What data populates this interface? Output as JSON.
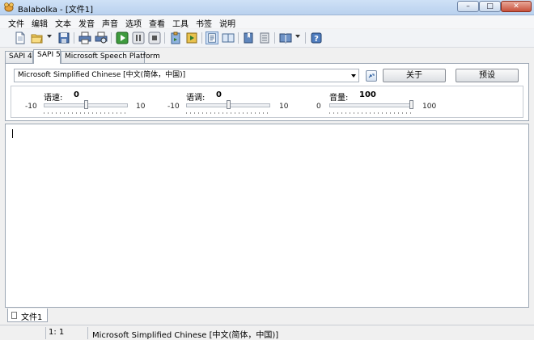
{
  "window": {
    "title": "Balabolka - [文件1]",
    "controls": {
      "minimize": "–",
      "maximize": "□",
      "close": "✕"
    }
  },
  "menu": [
    "文件",
    "编辑",
    "文本",
    "发音",
    "声音",
    "选项",
    "查看",
    "工具",
    "书签",
    "说明"
  ],
  "toolbar_icons": [
    "new-document-icon",
    "open-folder-icon",
    "save-icon",
    "print-icon",
    "print-preview-icon",
    "play-icon",
    "pause-icon",
    "stop-icon",
    "read-clipboard-icon",
    "convert-audio-icon",
    "text-view-icon",
    "split-view-icon",
    "bookmark-icon",
    "bookmarks-list-icon",
    "book-icon",
    "help-icon"
  ],
  "tabs": [
    "SAPI 4",
    "SAPI 5",
    "Microsoft Speech Platform"
  ],
  "selected_tab": "SAPI 5",
  "voice_panel": {
    "voice_value": "Microsoft Simplified Chinese [中文(简体，中国)]",
    "about_button": "关于",
    "preset_button": "预设"
  },
  "sliders": {
    "rate": {
      "label": "语速:",
      "value": "0",
      "min": "-10",
      "max": "10",
      "level": 0.5
    },
    "pitch": {
      "label": "语调:",
      "value": "0",
      "min": "-10",
      "max": "10",
      "level": 0.5
    },
    "volume": {
      "label": "音量:",
      "value": "100",
      "min": "0",
      "max": "100",
      "level": 1.0
    }
  },
  "document_tabs": [
    "文件1"
  ],
  "status": {
    "position": "1:  1",
    "voice": "Microsoft Simplified Chinese [中文(简体，中国)]"
  }
}
